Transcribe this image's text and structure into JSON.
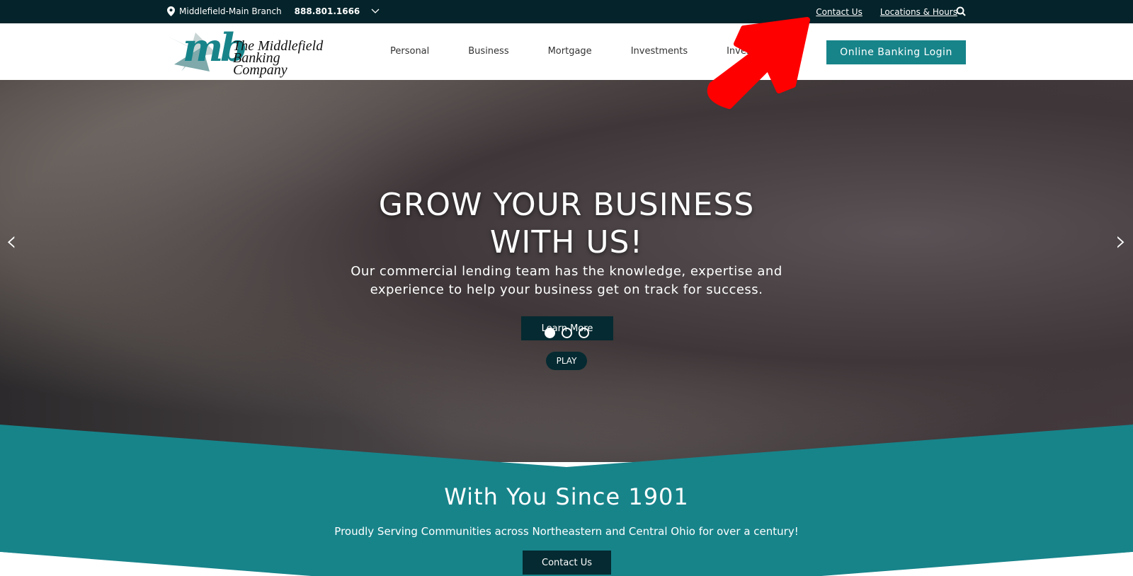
{
  "topbar": {
    "branch": "Middlefield-Main Branch",
    "phone": "888.801.1666",
    "links": [
      "Contact Us",
      "Locations & Hours"
    ]
  },
  "header": {
    "logo_mark": "mb",
    "logo_name_1": "The Middlefield",
    "logo_name_2": "Banking Company",
    "nav": [
      "Personal",
      "Business",
      "Mortgage",
      "Investments",
      "Investors"
    ],
    "login": "Online Banking Login"
  },
  "hero": {
    "title_1": "GROW YOUR BUSINESS",
    "title_2": "WITH US!",
    "subtitle_1": "Our commercial lending team has the knowledge, expertise and",
    "subtitle_2": "experience to help your business get on track for success.",
    "cta": "Learn More",
    "play": "PLAY",
    "slides": 3,
    "active_slide": 1
  },
  "band": {
    "title": "With You Since 1901",
    "text": "Proudly Serving Communities across Northeastern and Central Ohio for over a century!",
    "cta": "Contact Us"
  },
  "colors": {
    "teal": "#17848a",
    "dark": "#04232a",
    "annotation": "#ff0000"
  }
}
